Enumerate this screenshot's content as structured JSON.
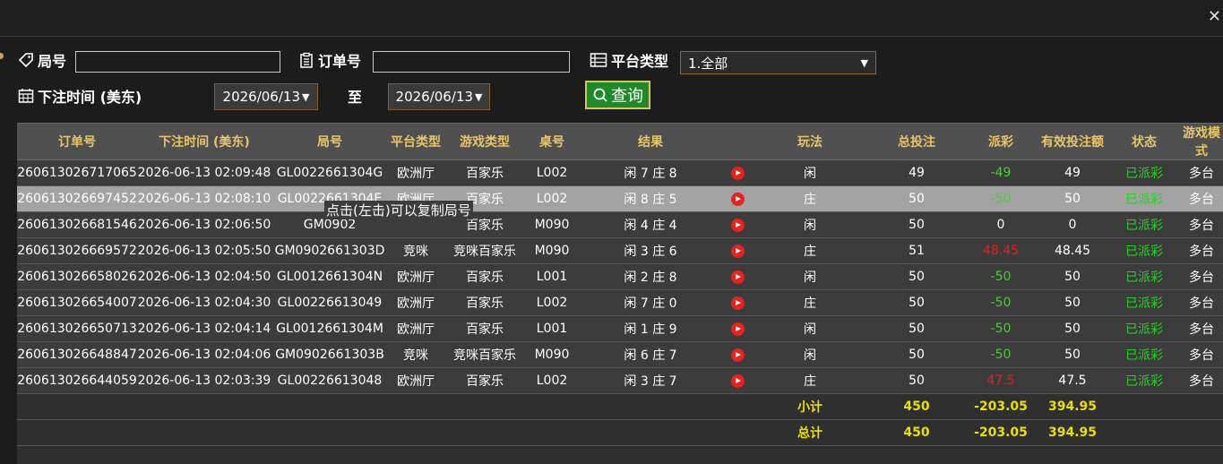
{
  "filters": {
    "round_label": "局号",
    "order_label": "订单号",
    "platform_label": "平台类型",
    "platform_value": "1.全部",
    "time_label": "下注时间 (美东)",
    "date_from": "2026/06/13",
    "to_label": "至",
    "date_to": "2026/06/13",
    "query_label": "查询"
  },
  "tooltip": "点击(左击)可以复制局号",
  "columns": [
    "订单号",
    "下注时间 (美东)",
    "局号",
    "平台类型",
    "游戏类型",
    "桌号",
    "结果",
    "",
    "玩法",
    "总投注",
    "派彩",
    "有效投注额",
    "状态",
    "游戏模式"
  ],
  "rows": [
    {
      "order": "260613026717065",
      "time": "2026-06-13 02:09:48",
      "round": "GL0022661304G",
      "platform": "欧洲厅",
      "game": "百家乐",
      "table": "L002",
      "result": "闲 7 庄 8",
      "bet": "闲",
      "total": "49",
      "payout": "-49",
      "payout_color": "green",
      "valid": "49",
      "status": "已派彩",
      "mode": "多台"
    },
    {
      "order": "260613026697452",
      "time": "2026-06-13 02:08:10",
      "round": "GL0022661304E",
      "platform": "欧洲厅",
      "game": "百家乐",
      "table": "L002",
      "result": "闲 8 庄 5",
      "bet": "庄",
      "total": "50",
      "payout": "-50",
      "payout_color": "green",
      "valid": "50",
      "status": "已派彩",
      "mode": "多台"
    },
    {
      "order": "260613026681546",
      "time": "2026-06-13 02:06:50",
      "round": "GM0902",
      "platform": "",
      "game": "百家乐",
      "table": "M090",
      "result": "闲 4 庄 4",
      "bet": "闲",
      "total": "50",
      "payout": "0",
      "payout_color": "white",
      "valid": "0",
      "status": "已派彩",
      "mode": "多台"
    },
    {
      "order": "260613026669572",
      "time": "2026-06-13 02:05:50",
      "round": "GM0902661303D",
      "platform": "竞咪",
      "game": "竞咪百家乐",
      "table": "M090",
      "result": "闲 3 庄 6",
      "bet": "庄",
      "total": "51",
      "payout": "48.45",
      "payout_color": "red",
      "valid": "48.45",
      "status": "已派彩",
      "mode": "多台"
    },
    {
      "order": "260613026658026",
      "time": "2026-06-13 02:04:50",
      "round": "GL0012661304N",
      "platform": "欧洲厅",
      "game": "百家乐",
      "table": "L001",
      "result": "闲 2 庄 8",
      "bet": "闲",
      "total": "50",
      "payout": "-50",
      "payout_color": "green",
      "valid": "50",
      "status": "已派彩",
      "mode": "多台"
    },
    {
      "order": "260613026654007",
      "time": "2026-06-13 02:04:30",
      "round": "GL00226613049",
      "platform": "欧洲厅",
      "game": "百家乐",
      "table": "L002",
      "result": "闲 7 庄 0",
      "bet": "庄",
      "total": "50",
      "payout": "-50",
      "payout_color": "green",
      "valid": "50",
      "status": "已派彩",
      "mode": "多台"
    },
    {
      "order": "260613026650713",
      "time": "2026-06-13 02:04:14",
      "round": "GL0012661304M",
      "platform": "欧洲厅",
      "game": "百家乐",
      "table": "L001",
      "result": "闲 1 庄 9",
      "bet": "闲",
      "total": "50",
      "payout": "-50",
      "payout_color": "green",
      "valid": "50",
      "status": "已派彩",
      "mode": "多台"
    },
    {
      "order": "260613026648847",
      "time": "2026-06-13 02:04:06",
      "round": "GM0902661303B",
      "platform": "竞咪",
      "game": "竞咪百家乐",
      "table": "M090",
      "result": "闲 6 庄 7",
      "bet": "闲",
      "total": "50",
      "payout": "-50",
      "payout_color": "green",
      "valid": "50",
      "status": "已派彩",
      "mode": "多台"
    },
    {
      "order": "260613026644059",
      "time": "2026-06-13 02:03:39",
      "round": "GL00226613048",
      "platform": "欧洲厅",
      "game": "百家乐",
      "table": "L002",
      "result": "闲 3 庄 7",
      "bet": "庄",
      "total": "50",
      "payout": "47.5",
      "payout_color": "red",
      "valid": "47.5",
      "status": "已派彩",
      "mode": "多台"
    }
  ],
  "subtotal": {
    "label": "小计",
    "total": "450",
    "payout": "-203.05",
    "valid": "394.95"
  },
  "grandtotal": {
    "label": "总计",
    "total": "450",
    "payout": "-203.05",
    "valid": "394.95"
  },
  "colors": {
    "header_text": "#e8c466",
    "status_green": "#22d422",
    "sum_yellow": "#e8e000",
    "loss_green": "#43d12b",
    "win_red": "#e02020"
  }
}
